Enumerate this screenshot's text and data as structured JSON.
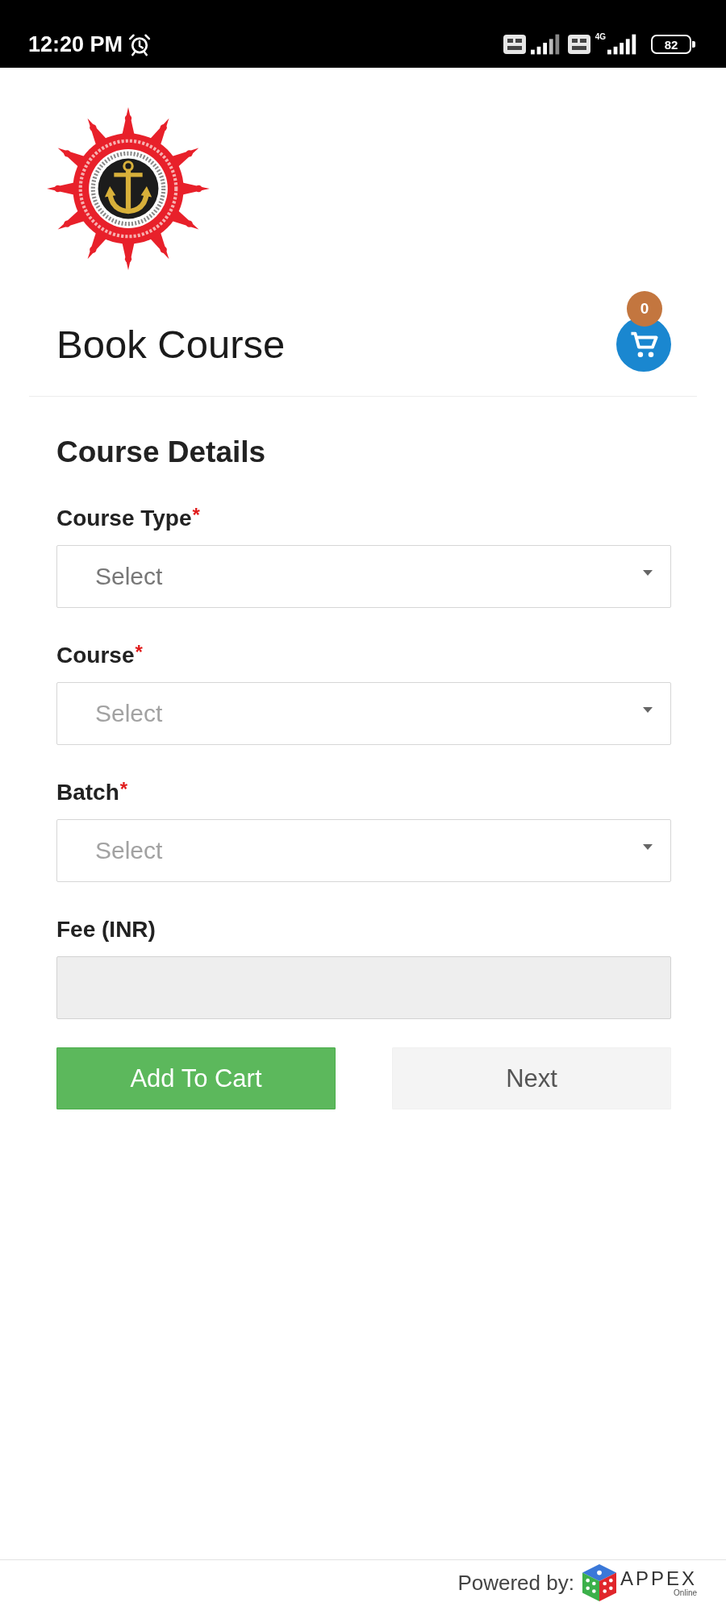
{
  "status_bar": {
    "time": "12:20 PM",
    "network_type": "4G",
    "battery": "82"
  },
  "header": {
    "title": "Book Course",
    "cart_count": "0"
  },
  "form": {
    "title": "Course Details",
    "fields": [
      {
        "kind": "select",
        "label": "Course Type",
        "required_mark": "*",
        "placeholder": "Select",
        "disabled": false
      },
      {
        "kind": "select",
        "label": "Course",
        "required_mark": "*",
        "placeholder": "Select",
        "disabled": true
      },
      {
        "kind": "select",
        "label": "Batch",
        "required_mark": "*",
        "placeholder": "Select",
        "disabled": true
      },
      {
        "kind": "text",
        "label": "Fee (INR)",
        "disabled": true
      }
    ]
  },
  "buttons": [
    {
      "label": "Add To Cart",
      "kind": "primary"
    },
    {
      "label": "Next",
      "kind": "secondary"
    }
  ],
  "footer": {
    "powered_by": "Powered by:",
    "brand": "APPEX",
    "tagline": "Online"
  }
}
